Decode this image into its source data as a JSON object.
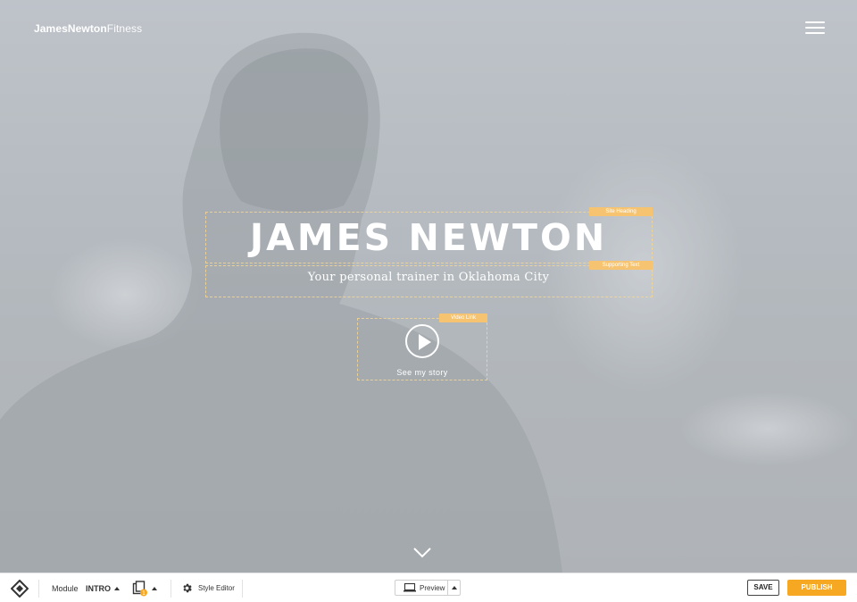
{
  "brand": {
    "bold": "JamesNewton",
    "light": "Fitness"
  },
  "hero": {
    "heading": "JAMES NEWTON",
    "heading_tag": "Site Heading",
    "supporting_text": "Your personal trainer in Oklahoma City",
    "supporting_tag": "Supporting Text",
    "video_tag": "Video Link",
    "video_caption": "See my story"
  },
  "toolbar": {
    "module_label": "Module",
    "module_value": "INTRO",
    "pages_badge": "1",
    "style_editor_label": "Style Editor",
    "preview_label": "Preview",
    "save_label": "SAVE",
    "publish_label": "PUBLISH"
  },
  "colors": {
    "accent": "#f7a823",
    "tag": "#f6c471",
    "overlay": "#cdd2d8"
  },
  "icons": [
    "menu-icon",
    "play-icon",
    "chevron-down-icon",
    "diamond-logo-icon",
    "pages-icon",
    "gear-icon",
    "monitor-icon"
  ]
}
